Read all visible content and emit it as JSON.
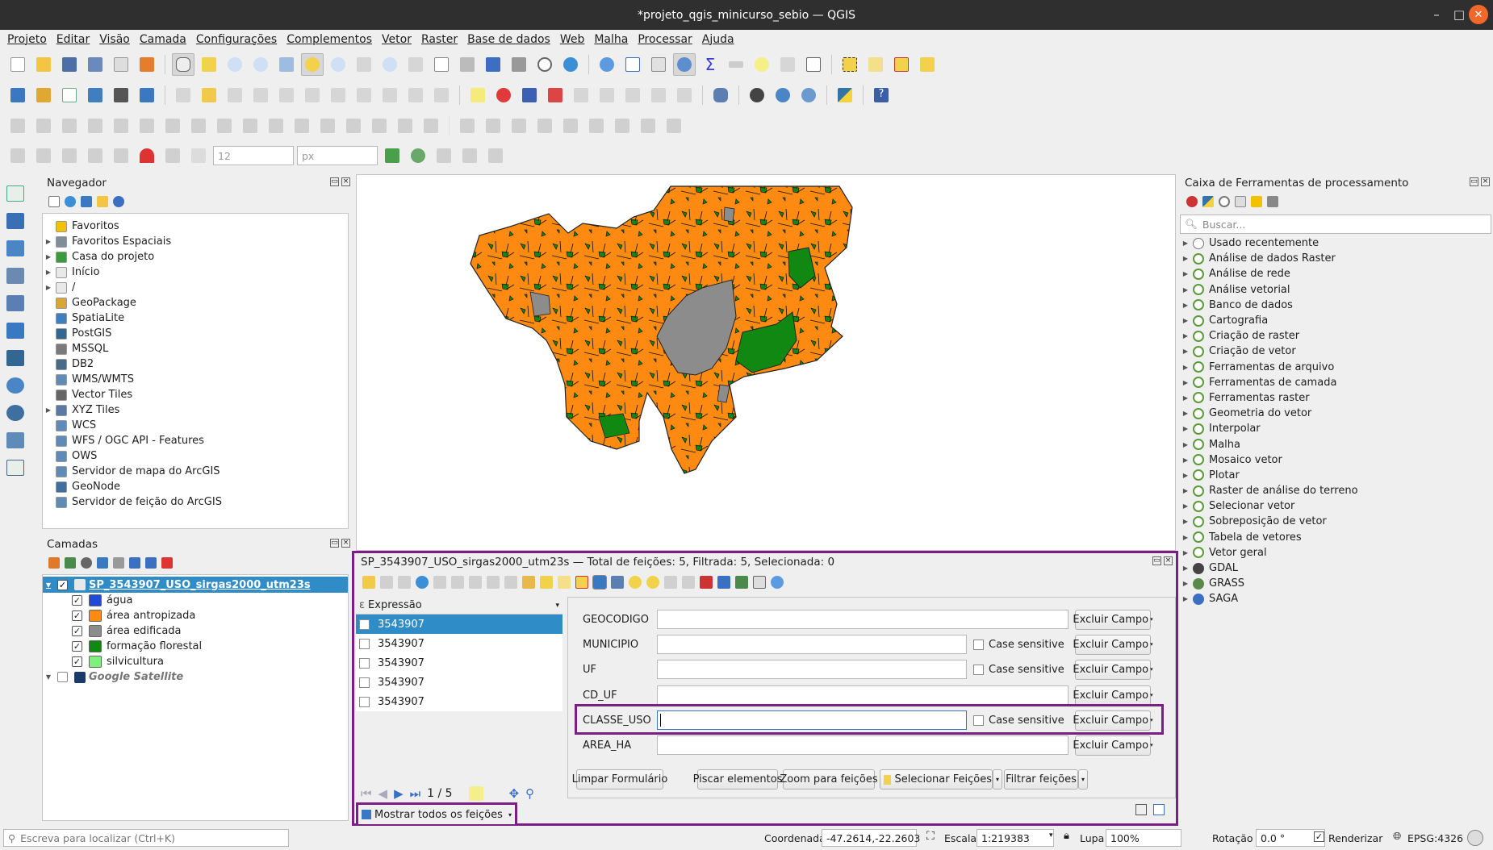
{
  "window": {
    "title": "*projeto_qgis_minicurso_sebio — QGIS"
  },
  "menu": [
    "Projeto",
    "Editar",
    "Visão",
    "Camada",
    "Configurações",
    "Complementos",
    "Vetor",
    "Raster",
    "Base de dados",
    "Web",
    "Malha",
    "Processar",
    "Ajuda"
  ],
  "toolbar": {
    "snap_size": "12",
    "snap_unit": "px"
  },
  "browser": {
    "title": "Navegador",
    "items": [
      {
        "label": "Favoritos",
        "icon": "star-icon",
        "expand": false,
        "color": "#f2c200"
      },
      {
        "label": "Favoritos Espaciais",
        "icon": "bookmark-icon",
        "expand": true,
        "color": "#7f8c9a"
      },
      {
        "label": "Casa do projeto",
        "icon": "project-home-icon",
        "expand": true,
        "color": "#3a9b3a"
      },
      {
        "label": "Início",
        "icon": "folder-icon",
        "expand": true,
        "color": "#e9e9e9"
      },
      {
        "label": "/",
        "icon": "folder-icon",
        "expand": true,
        "color": "#e9e9e9"
      },
      {
        "label": "GeoPackage",
        "icon": "geopackage-icon",
        "expand": false,
        "color": "#d8a636"
      },
      {
        "label": "SpatiaLite",
        "icon": "spatialite-icon",
        "expand": false,
        "color": "#3f7fbf"
      },
      {
        "label": "PostGIS",
        "icon": "postgis-icon",
        "expand": false,
        "color": "#336791"
      },
      {
        "label": "MSSQL",
        "icon": "mssql-icon",
        "expand": false,
        "color": "#7a7a7a"
      },
      {
        "label": "DB2",
        "icon": "db2-icon",
        "expand": false,
        "color": "#4a6a8a"
      },
      {
        "label": "WMS/WMTS",
        "icon": "globe-icon",
        "expand": false,
        "color": "#5f8bb8"
      },
      {
        "label": "Vector Tiles",
        "icon": "grid-icon",
        "expand": false,
        "color": "#666666"
      },
      {
        "label": "XYZ Tiles",
        "icon": "grid-icon",
        "expand": true,
        "color": "#5a7aa5"
      },
      {
        "label": "WCS",
        "icon": "globe-icon",
        "expand": false,
        "color": "#5f8bb8"
      },
      {
        "label": "WFS / OGC API - Features",
        "icon": "globe-icon",
        "expand": false,
        "color": "#5f8bb8"
      },
      {
        "label": "OWS",
        "icon": "globe-icon",
        "expand": false,
        "color": "#5f8bb8"
      },
      {
        "label": "Servidor de mapa do ArcGIS",
        "icon": "globe-icon",
        "expand": false,
        "color": "#5f8bb8"
      },
      {
        "label": "GeoNode",
        "icon": "geonode-icon",
        "expand": false,
        "color": "#3f6fa0"
      },
      {
        "label": "Servidor de feição do ArcGIS",
        "icon": "globe-icon",
        "expand": false,
        "color": "#5f8bb8"
      }
    ]
  },
  "layers": {
    "title": "Camadas",
    "group": "SP_3543907_USO_sirgas2000_utm23s",
    "classes": [
      {
        "label": "água",
        "color": "#1f4bd8"
      },
      {
        "label": "área antropizada",
        "color": "#ff8a11"
      },
      {
        "label": "área edificada",
        "color": "#8c8c8c"
      },
      {
        "label": "formação florestal",
        "color": "#118811"
      },
      {
        "label": "silvicultura",
        "color": "#7ff07f"
      }
    ],
    "satellite": "Google Satellite"
  },
  "processing": {
    "title": "Caixa de Ferramentas de processamento",
    "search_placeholder": "Buscar...",
    "items": [
      "Usado recentemente",
      "Análise de dados Raster",
      "Análise de rede",
      "Análise vetorial",
      "Banco de dados",
      "Cartografia",
      "Criação de raster",
      "Criação de vetor",
      "Ferramentas de arquivo",
      "Ferramentas de camada",
      "Ferramentas raster",
      "Geometria do vetor",
      "Interpolar",
      "Malha",
      "Mosaico vetor",
      "Plotar",
      "Raster de análise do terreno",
      "Selecionar vetor",
      "Sobreposição de vetor",
      "Tabela de vetores",
      "Vetor geral",
      "GDAL",
      "GRASS",
      "SAGA"
    ]
  },
  "attribute": {
    "title": "SP_3543907_USO_sirgas2000_utm23s — Total de feições: 5, Filtrada: 5, Selecionada: 0",
    "expression_label": "Expressão",
    "features": [
      "3543907",
      "3543907",
      "3543907",
      "3543907",
      "3543907"
    ],
    "nav": "1 / 5",
    "fields": [
      {
        "name": "GEOCODIGO",
        "case": false
      },
      {
        "name": "MUNICIPIO",
        "case": true
      },
      {
        "name": "UF",
        "case": true
      },
      {
        "name": "CD_UF",
        "case": false
      },
      {
        "name": "CLASSE_USO",
        "case": true
      },
      {
        "name": "AREA_HA",
        "case": false
      }
    ],
    "case_label": "Case sensitive",
    "exclude_label": "Excluir Campo",
    "buttons": {
      "clear": "Limpar Formulário",
      "flash": "Piscar elementos",
      "zoom": "Zoom para feições",
      "select": "Selecionar Feições",
      "filter": "Filtrar feições"
    },
    "show_all": "Mostrar todos os feições"
  },
  "status": {
    "locator_placeholder": "Escreva para localizar (Ctrl+K)",
    "coord_label": "Coordenada",
    "coord": "-47.2614,-22.2603",
    "scale_label": "Escala",
    "scale": "1:219383",
    "mag_label": "Lupa",
    "mag": "100%",
    "rot_label": "Rotação",
    "rot": "0.0 °",
    "render_label": "Renderizar",
    "crs": "EPSG:4326"
  },
  "colors": {
    "accent": "#7b1f86",
    "selection": "#308cc6",
    "orange": "#ff8a11",
    "green": "#118811",
    "gray": "#8c8c8c"
  }
}
